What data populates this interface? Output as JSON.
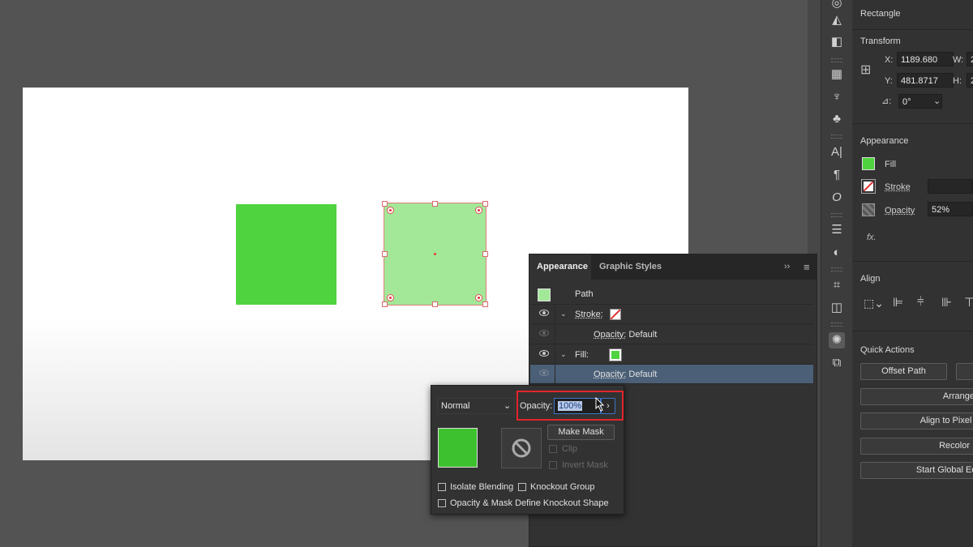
{
  "properties": {
    "object_type": "Rectangle",
    "transform": {
      "title": "Transform",
      "x_label": "X:",
      "x_value": "1189.680",
      "y_label": "Y:",
      "y_value": "481.8717",
      "w_label": "W:",
      "w_value": "2",
      "h_label": "H:",
      "h_value": "2",
      "angle_value": "0°"
    },
    "appearance": {
      "title": "Appearance",
      "fill_label": "Fill",
      "stroke_label": "Stroke",
      "opacity_label": "Opacity",
      "opacity_value": "52%",
      "fx_label": "fx."
    },
    "align": {
      "title": "Align"
    },
    "quick_actions": {
      "title": "Quick Actions",
      "offset_path": "Offset Path",
      "arrange": "Arrange",
      "align_to_pixel": "Align to Pixel G",
      "recolor": "Recolor",
      "start_global_edit": "Start Global Edit"
    }
  },
  "appearance_panel": {
    "tabs": [
      "Appearance",
      "Graphic Styles"
    ],
    "rows": {
      "path": "Path",
      "stroke": "Stroke:",
      "stroke_opacity_label": "Opacity:",
      "stroke_opacity_value": "Default",
      "fill": "Fill:",
      "fill_opacity_label": "Opacity:",
      "fill_opacity_value": "Default"
    }
  },
  "transparency_popup": {
    "blend_mode": "Normal",
    "opacity_label": "Opacity:",
    "opacity_value": "100%",
    "make_mask": "Make Mask",
    "clip": "Clip",
    "invert_mask": "Invert Mask",
    "isolate_blending": "Isolate Blending",
    "knockout_group": "Knockout Group",
    "opacity_mask_define": "Opacity & Mask Define Knockout Shape"
  },
  "colors": {
    "fill_green": "#4fd33f",
    "fill_green_light": "#a3e899",
    "selection": "#e05050",
    "highlight_box": "#e3242b"
  }
}
